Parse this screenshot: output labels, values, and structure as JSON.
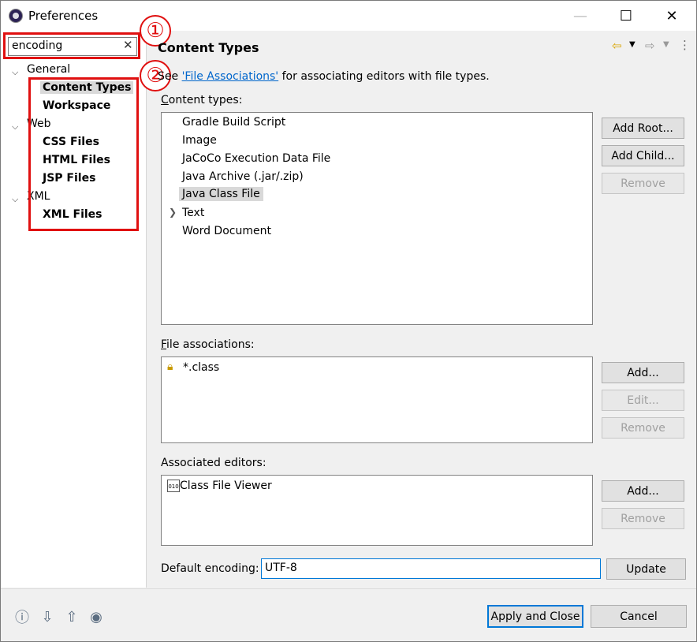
{
  "window": {
    "title": "Preferences"
  },
  "titlebar": {
    "minimize": "—",
    "maximize": "☐",
    "close": "✕"
  },
  "filter": {
    "value": "encoding",
    "clear": "✕"
  },
  "tree": {
    "general": "General",
    "content_types": "Content Types",
    "workspace": "Workspace",
    "web": "Web",
    "css_files": "CSS Files",
    "html_files": "HTML Files",
    "jsp_files": "JSP Files",
    "xml": "XML",
    "xml_files": "XML Files"
  },
  "callouts": {
    "one": "①",
    "two": "②"
  },
  "page": {
    "title": "Content Types",
    "see_prefix": "See ",
    "see_link": "'File Associations'",
    "see_suffix": " for associating editors with file types.",
    "content_types_label": "Content types:",
    "content_types": [
      "Gradle Build Script",
      "Image",
      "JaCoCo Execution Data File",
      "Java Archive (.jar/.zip)",
      "Java Class File",
      "Text",
      "Word Document"
    ],
    "file_assoc_label": "File associations:",
    "file_assoc": [
      "*.class"
    ],
    "assoc_editors_label": "Associated editors:",
    "assoc_editors": [
      "Class File Viewer"
    ],
    "default_encoding_label": "Default encoding:",
    "default_encoding_value": "UTF-8"
  },
  "buttons": {
    "add_root": "Add Root...",
    "add_child": "Add Child...",
    "remove": "Remove",
    "add": "Add...",
    "edit": "Edit...",
    "update": "Update",
    "apply_close": "Apply and Close",
    "cancel": "Cancel"
  }
}
